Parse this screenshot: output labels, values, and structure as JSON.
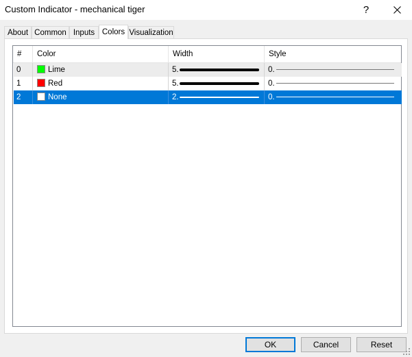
{
  "window": {
    "title": "Custom Indicator - mechanical tiger",
    "help_label": "?",
    "close_icon": "close-icon"
  },
  "tabs": [
    {
      "label": "About"
    },
    {
      "label": "Common"
    },
    {
      "label": "Inputs"
    },
    {
      "label": "Colors",
      "active": true
    },
    {
      "label": "Visualization"
    }
  ],
  "grid": {
    "headers": {
      "index": "#",
      "color": "Color",
      "width": "Width",
      "style": "Style"
    },
    "rows": [
      {
        "index": "0",
        "color_name": "Lime",
        "swatch": "#00ff00",
        "width": "5.",
        "style": "0."
      },
      {
        "index": "1",
        "color_name": "Red",
        "swatch": "#ff0000",
        "width": "5.",
        "style": "0."
      },
      {
        "index": "2",
        "color_name": "None",
        "swatch": "#ffffff",
        "width": "2.",
        "style": "0.",
        "selected": true
      }
    ]
  },
  "buttons": {
    "ok": "OK",
    "cancel": "Cancel",
    "reset": "Reset"
  },
  "colors": {
    "accent": "#0078d7",
    "selected_text": "#ffffff"
  }
}
